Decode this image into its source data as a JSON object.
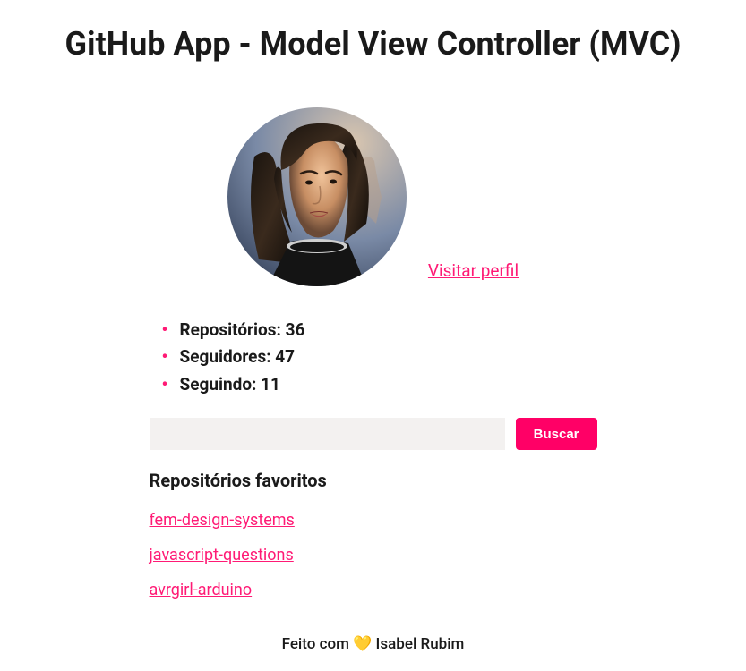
{
  "title": "GitHub App - Model View Controller (MVC)",
  "profile": {
    "visit_label": "Visitar perfil"
  },
  "stats": {
    "repos_label": "Repositórios: 36",
    "followers_label": "Seguidores: 47",
    "following_label": "Seguindo: 11"
  },
  "search": {
    "button_label": "Buscar",
    "input_value": ""
  },
  "favorites": {
    "heading": "Repositórios favoritos",
    "items": [
      {
        "name": "fem-design-systems"
      },
      {
        "name": "javascript-questions"
      },
      {
        "name": "avrgirl-arduino"
      }
    ]
  },
  "footer": {
    "pre": "Feito com ",
    "heart": "💛",
    "post": " Isabel Rubim"
  }
}
